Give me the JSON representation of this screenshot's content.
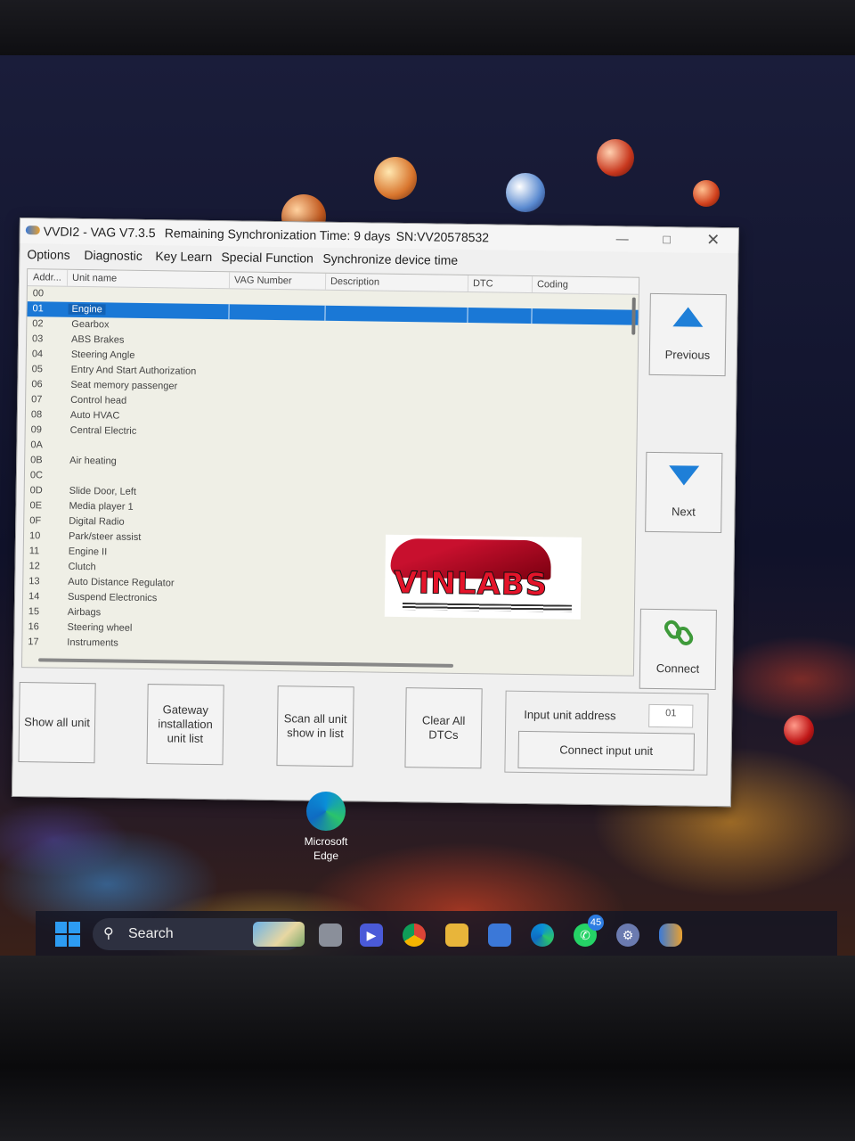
{
  "window": {
    "app_title": "VVDI2 - VAG V7.3.5",
    "sync_text": "Remaining Synchronization Time: 9 days",
    "serial": "SN:VV20578532"
  },
  "menu": [
    "Options",
    "Diagnostic",
    "Key Learn",
    "Special Function",
    "Synchronize device time"
  ],
  "table": {
    "columns": [
      "Addr...",
      "Unit name",
      "VAG Number",
      "Description",
      "DTC",
      "Coding"
    ],
    "selected_address": "01",
    "rows": [
      {
        "addr": "00",
        "name": ""
      },
      {
        "addr": "01",
        "name": "Engine"
      },
      {
        "addr": "02",
        "name": "Gearbox"
      },
      {
        "addr": "03",
        "name": "ABS Brakes"
      },
      {
        "addr": "04",
        "name": "Steering Angle"
      },
      {
        "addr": "05",
        "name": "Entry And Start Authorization"
      },
      {
        "addr": "06",
        "name": "Seat memory passenger"
      },
      {
        "addr": "07",
        "name": "Control head"
      },
      {
        "addr": "08",
        "name": "Auto HVAC"
      },
      {
        "addr": "09",
        "name": "Central Electric"
      },
      {
        "addr": "0A",
        "name": ""
      },
      {
        "addr": "0B",
        "name": "Air heating"
      },
      {
        "addr": "0C",
        "name": ""
      },
      {
        "addr": "0D",
        "name": "Slide Door, Left"
      },
      {
        "addr": "0E",
        "name": "Media player 1"
      },
      {
        "addr": "0F",
        "name": "Digital Radio"
      },
      {
        "addr": "10",
        "name": "Park/steer assist"
      },
      {
        "addr": "11",
        "name": "Engine II"
      },
      {
        "addr": "12",
        "name": "Clutch"
      },
      {
        "addr": "13",
        "name": "Auto Distance Regulator"
      },
      {
        "addr": "14",
        "name": "Suspend Electronics"
      },
      {
        "addr": "15",
        "name": "Airbags"
      },
      {
        "addr": "16",
        "name": "Steering wheel"
      },
      {
        "addr": "17",
        "name": "Instruments"
      }
    ]
  },
  "nav": {
    "previous": "Previous",
    "next": "Next",
    "connect": "Connect"
  },
  "actions": {
    "show_all": "Show all unit",
    "gateway": "Gateway installation unit list",
    "scan_all": "Scan all unit show in list",
    "clear_dtcs": "Clear All DTCs"
  },
  "input_unit": {
    "label": "Input unit address",
    "value": "01",
    "button": "Connect input unit"
  },
  "logo": {
    "text": "VINLABS"
  },
  "desktop": {
    "edge_label": "Microsoft Edge"
  },
  "taskbar": {
    "search": "Search",
    "whatsapp_badge": "45"
  },
  "colors": {
    "selection": "#1a78d6",
    "nav_arrow": "#1e7fd8",
    "list_bg": "#efefe6"
  }
}
